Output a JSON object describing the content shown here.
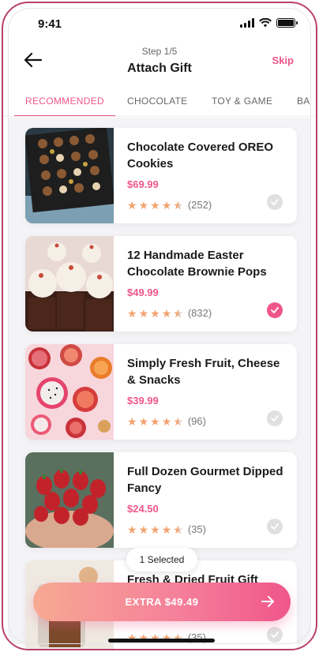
{
  "status_bar": {
    "time": "9:41"
  },
  "header": {
    "step": "Step 1/5",
    "title": "Attach Gift",
    "skip_label": "Skip"
  },
  "tabs": [
    {
      "label": "RECOMMENDED",
      "active": true
    },
    {
      "label": "CHOCOLATE",
      "active": false
    },
    {
      "label": "TOY & GAME",
      "active": false
    },
    {
      "label": "BA",
      "active": false
    }
  ],
  "products": [
    {
      "name": "Chocolate Covered OREO Cookies",
      "price": "$69.99",
      "rating": 4.5,
      "reviews": "(252)",
      "selected": false,
      "image": "chocolate-box"
    },
    {
      "name": "12 Handmade Easter Chocolate Brownie Pops",
      "price": "$49.99",
      "rating": 4.5,
      "reviews": "(832)",
      "selected": true,
      "image": "cupcakes"
    },
    {
      "name": "Simply Fresh Fruit, Cheese & Snacks",
      "price": "$39.99",
      "rating": 4.5,
      "reviews": "(96)",
      "selected": false,
      "image": "fruit-platter"
    },
    {
      "name": "Full Dozen Gourmet Dipped Fancy",
      "price": "$24.50",
      "rating": 4.5,
      "reviews": "(35)",
      "selected": false,
      "image": "strawberries"
    },
    {
      "name": "Fresh & Dried Fruit Gift",
      "price": "",
      "rating": 4.5,
      "reviews": "(35)",
      "selected": false,
      "image": "dried-fruit"
    }
  ],
  "selection": {
    "label": "1 Selected"
  },
  "cta": {
    "label": "EXTRA $49.49"
  },
  "icons": {
    "back": "arrow-left-icon",
    "cta": "arrow-right-icon",
    "check": "check-icon",
    "star": "star-icon"
  },
  "colors": {
    "accent": "#f0568a",
    "star": "#f3a26f",
    "check_off": "#e0e0e0"
  }
}
